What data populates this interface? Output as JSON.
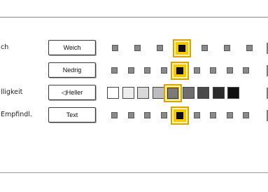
{
  "rows": [
    {
      "label": "ch",
      "button": "Weich",
      "levels": 7,
      "selected": 4,
      "style": "dots"
    },
    {
      "label": "",
      "button": "Nedrig",
      "levels": 9,
      "selected": 5,
      "style": "dots"
    },
    {
      "label": "lligkeit",
      "button": "◁Heller",
      "levels": 9,
      "selected": 5,
      "style": "gradient",
      "shades": [
        "#ffffff",
        "#eeeeee",
        "#d8d8d8",
        "#bdbdbd",
        "#9a9a9a",
        "#6e6e6e",
        "#4a4a4a",
        "#2c2c2c",
        "#101010"
      ]
    },
    {
      "label": "Empfindl.",
      "button": "Text",
      "levels": 9,
      "selected": 5,
      "style": "dots"
    }
  ]
}
